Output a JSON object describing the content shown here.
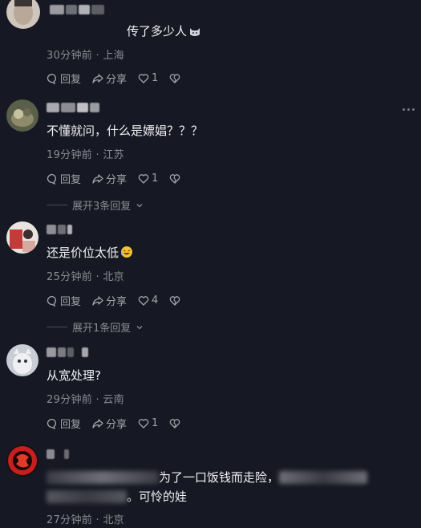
{
  "comments": [
    {
      "text": "传了多少人",
      "meta": "30分钟前 · 上海",
      "likes": "1",
      "reply_label": "回复",
      "share_label": "分享"
    },
    {
      "text": "不懂就问，什么是嫖娼？？？",
      "meta": "19分钟前 · 江苏",
      "likes": "1",
      "reply_label": "回复",
      "share_label": "分享",
      "expand": "展开3条回复"
    },
    {
      "text": "还是价位太低",
      "meta": "25分钟前 · 北京",
      "likes": "4",
      "reply_label": "回复",
      "share_label": "分享",
      "expand": "展开1条回复"
    },
    {
      "text": "从宽处理?",
      "meta": "29分钟前 · 云南",
      "likes": "1",
      "reply_label": "回复",
      "share_label": "分享"
    },
    {
      "text_line1": "为了一口饭钱而走险，",
      "text_line2": "。可怜的娃",
      "meta": "27分钟前 · 北京"
    }
  ],
  "colors": {
    "background": "#161823",
    "primary_text": "#f2f2f5",
    "secondary_text": "#8a8b93"
  }
}
